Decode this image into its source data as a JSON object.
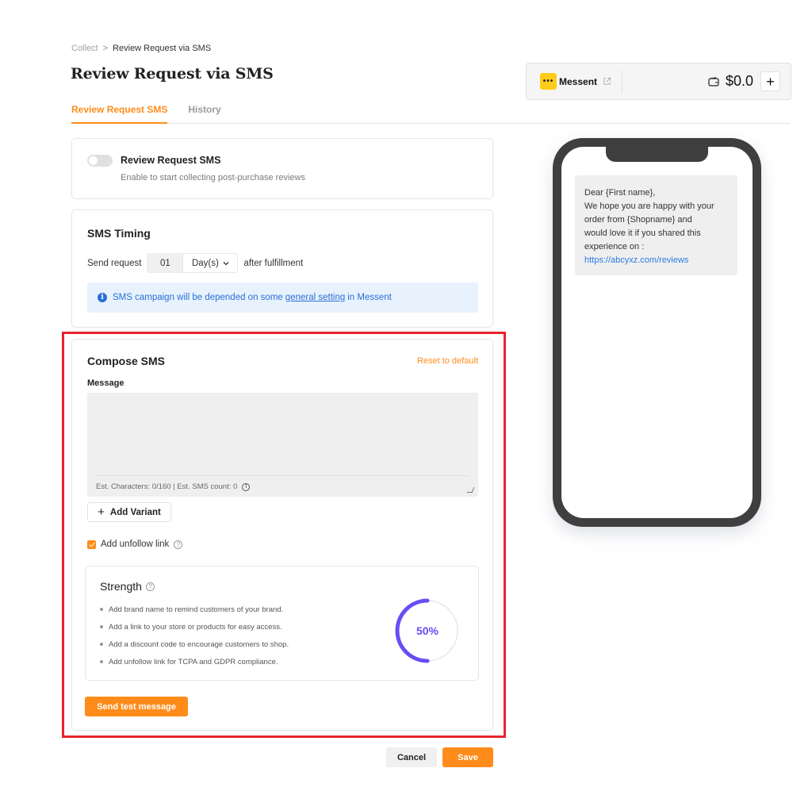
{
  "breadcrumb": {
    "parent": "Collect",
    "separator": ">",
    "current": "Review Request via SMS"
  },
  "page": {
    "title": "Review Request via SMS"
  },
  "tabs": [
    {
      "label": "Review Request SMS",
      "active": true
    },
    {
      "label": "History",
      "active": false
    }
  ],
  "account": {
    "brand_logo": "•••",
    "brand_name": "Messent",
    "balance": "$0.0",
    "add_label": "+",
    "icons": {
      "external": "external-link-icon",
      "wallet": "wallet-icon"
    }
  },
  "toggle_card": {
    "title": "Review Request SMS",
    "description": "Enable to start collecting post-purchase reviews",
    "enabled": false
  },
  "timing": {
    "title": "SMS Timing",
    "prefix": "Send request",
    "value": "01",
    "unit": "Day(s)",
    "suffix": "after fulfillment",
    "info_before": "SMS campaign will be depended on some",
    "info_link": "general setting",
    "info_after": "in Messent",
    "info_color": "#2a6fd6"
  },
  "compose": {
    "title": "Compose SMS",
    "reset_label": "Reset to default",
    "message_label": "Message",
    "message_value": "",
    "counter": "Est. Characters: 0/160 | Est. SMS count: 0",
    "add_variant_label": "Add Variant",
    "unfollow_label": "Add unfollow link",
    "unfollow_checked": true,
    "strength": {
      "title": "Strength",
      "tips": [
        "Add brand name to remind customers of your brand.",
        "Add a link to your store or products for easy access.",
        "Add a discount code to encourage customers to shop.",
        "Add unfollow link for TCPA and GDPR compliance."
      ],
      "percent": 50,
      "percent_label": "50%",
      "color": "#6a4cf5"
    },
    "send_test_label": "Send test message"
  },
  "actions": {
    "cancel": "Cancel",
    "save": "Save"
  },
  "preview": {
    "lines": [
      "Dear {First name},",
      "We hope you are happy with your",
      "order from {Shopname} and",
      "would love it if you shared this",
      "experience on :"
    ],
    "link": "https://abcyxz.com/reviews"
  },
  "colors": {
    "accent": "#ff8c1a",
    "highlight": "#e8232f",
    "phone_frame": "#3f3f3f"
  }
}
